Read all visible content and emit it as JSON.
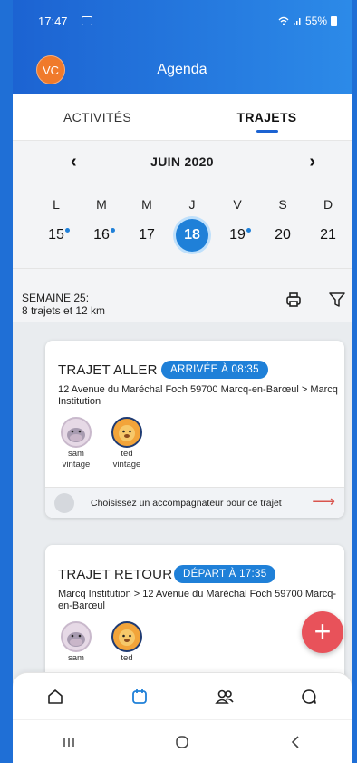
{
  "status": {
    "time": "17:47",
    "battery": "55%"
  },
  "header": {
    "avatar_initials": "VC",
    "title": "Agenda"
  },
  "tabs": [
    {
      "label": "ACTIVITÉS",
      "active": false
    },
    {
      "label": "TRAJETS",
      "active": true
    }
  ],
  "calendar": {
    "month": "JUIN 2020",
    "days": [
      {
        "dow": "L",
        "num": "15",
        "dot": true,
        "selected": false
      },
      {
        "dow": "M",
        "num": "16",
        "dot": true,
        "selected": false
      },
      {
        "dow": "M",
        "num": "17",
        "dot": false,
        "selected": false
      },
      {
        "dow": "J",
        "num": "18",
        "dot": false,
        "selected": true
      },
      {
        "dow": "V",
        "num": "19",
        "dot": true,
        "selected": false
      },
      {
        "dow": "S",
        "num": "20",
        "dot": false,
        "selected": false
      },
      {
        "dow": "D",
        "num": "21",
        "dot": false,
        "selected": false
      }
    ]
  },
  "week": {
    "line1": "SEMAINE 25:",
    "line2": "8 trajets et 12 km"
  },
  "trips": [
    {
      "title": "TRAJET ALLER",
      "badge": "ARRIVÉE À 08:35",
      "address": "12 Avenue du Maréchal Foch 59700 Marcq-en-Barœul > Marcq Institution",
      "kids": [
        {
          "first": "sam",
          "last": "vintage"
        },
        {
          "first": "ted",
          "last": "vintage"
        }
      ],
      "escort_text": "Choisissez un accompagnateur pour ce trajet"
    },
    {
      "title": "TRAJET RETOUR",
      "badge": "DÉPART À 17:35",
      "address": "Marcq Institution > 12 Avenue du Maréchal Foch 59700 Marcq-en-Barœul",
      "kids": [
        {
          "first": "sam",
          "last": ""
        },
        {
          "first": "ted",
          "last": ""
        }
      ]
    }
  ],
  "fab": {
    "label": "+"
  },
  "colors": {
    "primary": "#1f80d8",
    "header": "#1c63d2",
    "accent": "#e8525a",
    "avatar": "#f07a2b"
  }
}
